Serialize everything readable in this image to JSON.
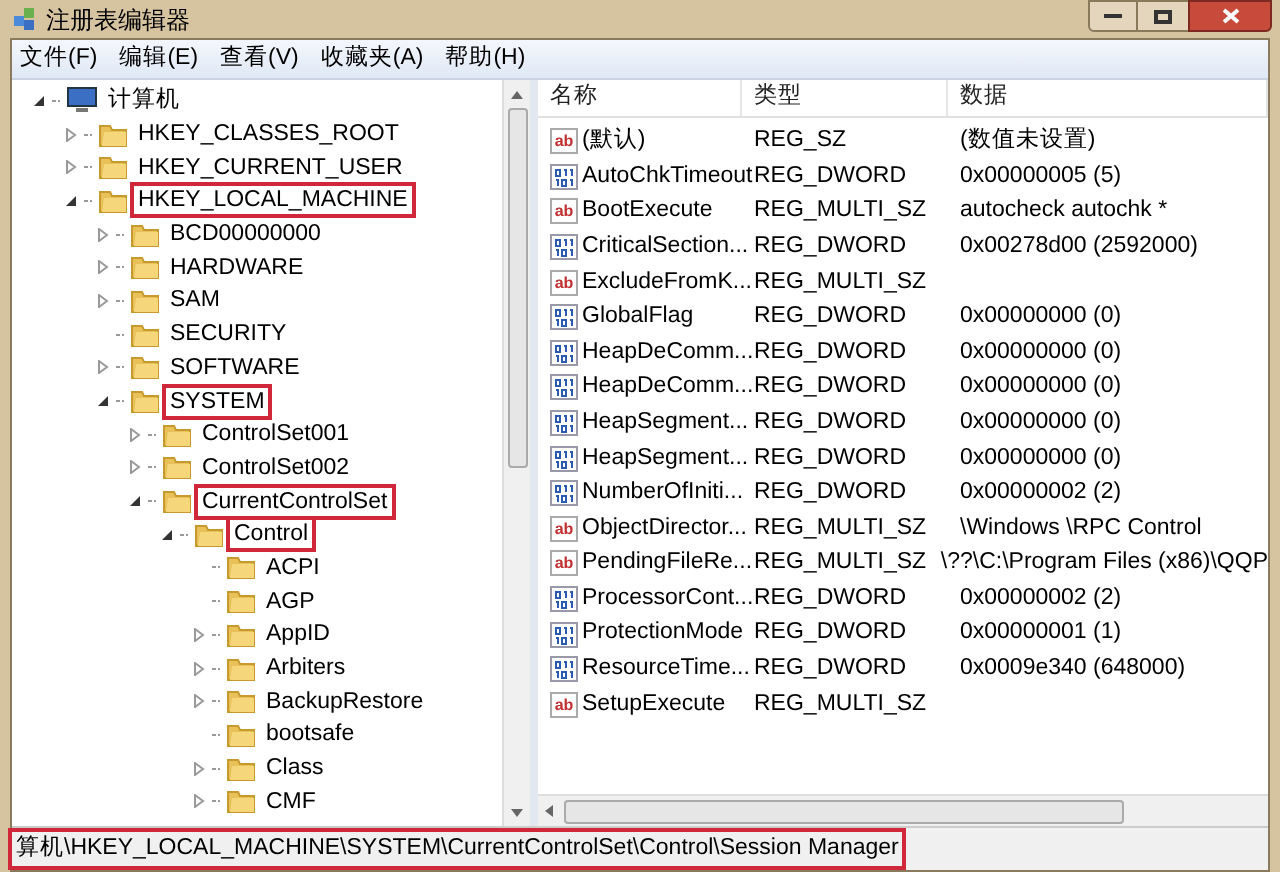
{
  "window": {
    "title": "注册表编辑器"
  },
  "menu": [
    "文件(F)",
    "编辑(E)",
    "查看(V)",
    "收藏夹(A)",
    "帮助(H)"
  ],
  "tree": [
    {
      "label": "计算机",
      "kind": "computer",
      "expanded": true,
      "highlighted": false,
      "children": [
        {
          "label": "HKEY_CLASSES_ROOT",
          "kind": "folder",
          "expanded": false,
          "highlighted": false
        },
        {
          "label": "HKEY_CURRENT_USER",
          "kind": "folder",
          "expanded": false,
          "highlighted": false
        },
        {
          "label": "HKEY_LOCAL_MACHINE",
          "kind": "folder",
          "expanded": true,
          "highlighted": true,
          "children": [
            {
              "label": "BCD00000000",
              "kind": "folder",
              "expanded": false,
              "highlighted": false
            },
            {
              "label": "HARDWARE",
              "kind": "folder",
              "expanded": false,
              "highlighted": false
            },
            {
              "label": "SAM",
              "kind": "folder",
              "expanded": false,
              "highlighted": false
            },
            {
              "label": "SECURITY",
              "kind": "folder",
              "highlighted": false
            },
            {
              "label": "SOFTWARE",
              "kind": "folder",
              "expanded": false,
              "highlighted": false
            },
            {
              "label": "SYSTEM",
              "kind": "folder",
              "expanded": true,
              "highlighted": true,
              "children": [
                {
                  "label": "ControlSet001",
                  "kind": "folder",
                  "expanded": false,
                  "highlighted": false
                },
                {
                  "label": "ControlSet002",
                  "kind": "folder",
                  "expanded": false,
                  "highlighted": false
                },
                {
                  "label": "CurrentControlSet",
                  "kind": "folder",
                  "expanded": true,
                  "highlighted": true,
                  "children": [
                    {
                      "label": "Control",
                      "kind": "folder",
                      "expanded": true,
                      "highlighted": true,
                      "children": [
                        {
                          "label": "ACPI",
                          "kind": "folder",
                          "highlighted": false
                        },
                        {
                          "label": "AGP",
                          "kind": "folder",
                          "highlighted": false
                        },
                        {
                          "label": "AppID",
                          "kind": "folder",
                          "expanded": false,
                          "highlighted": false
                        },
                        {
                          "label": "Arbiters",
                          "kind": "folder",
                          "expanded": false,
                          "highlighted": false
                        },
                        {
                          "label": "BackupRestore",
                          "kind": "folder",
                          "expanded": false,
                          "highlighted": false
                        },
                        {
                          "label": "bootsafe",
                          "kind": "folder",
                          "highlighted": false
                        },
                        {
                          "label": "Class",
                          "kind": "folder",
                          "expanded": false,
                          "highlighted": false
                        },
                        {
                          "label": "CMF",
                          "kind": "folder",
                          "expanded": false,
                          "highlighted": false
                        }
                      ]
                    }
                  ]
                }
              ]
            }
          ]
        }
      ]
    }
  ],
  "table": {
    "columns": [
      "名称",
      "类型",
      "数据"
    ],
    "rows": [
      {
        "kind": "string",
        "icon": "ab",
        "name": "(默认)",
        "type": "REG_SZ",
        "data": "(数值未设置)"
      },
      {
        "kind": "binary",
        "name": "AutoChkTimeout",
        "type": "REG_DWORD",
        "data": "0x00000005 (5)"
      },
      {
        "kind": "string",
        "icon": "ab",
        "name": "BootExecute",
        "type": "REG_MULTI_SZ",
        "data": "autocheck autochk *"
      },
      {
        "kind": "binary",
        "name": "CriticalSection...",
        "type": "REG_DWORD",
        "data": "0x00278d00 (2592000)"
      },
      {
        "kind": "string",
        "icon": "ab",
        "name": "ExcludeFromK...",
        "type": "REG_MULTI_SZ"
      },
      {
        "kind": "binary",
        "name": "GlobalFlag",
        "type": "REG_DWORD",
        "data": "0x00000000 (0)"
      },
      {
        "kind": "binary",
        "name": "HeapDeComm...",
        "type": "REG_DWORD",
        "data": "0x00000000 (0)"
      },
      {
        "kind": "binary",
        "name": "HeapDeComm...",
        "type": "REG_DWORD",
        "data": "0x00000000 (0)"
      },
      {
        "kind": "binary",
        "name": "HeapSegment...",
        "type": "REG_DWORD",
        "data": "0x00000000 (0)"
      },
      {
        "kind": "binary",
        "name": "HeapSegment...",
        "type": "REG_DWORD",
        "data": "0x00000000 (0)"
      },
      {
        "kind": "binary",
        "name": "NumberOfIniti...",
        "type": "REG_DWORD",
        "data": "0x00000002 (2)"
      },
      {
        "kind": "string",
        "icon": "ab",
        "name": "ObjectDirector...",
        "type": "REG_MULTI_SZ",
        "data": "\\Windows \\RPC Control"
      },
      {
        "kind": "string",
        "icon": "ab",
        "name": "PendingFileRe...",
        "type": "REG_MULTI_SZ",
        "data": "\\??\\C:\\Program Files (x86)\\QQP"
      },
      {
        "kind": "binary",
        "name": "ProcessorCont...",
        "type": "REG_DWORD",
        "data": "0x00000002 (2)"
      },
      {
        "kind": "binary",
        "name": "ProtectionMode",
        "type": "REG_DWORD",
        "data": "0x00000001 (1)"
      },
      {
        "kind": "binary",
        "name": "ResourceTime...",
        "type": "REG_DWORD",
        "data": "0x0009e340 (648000)"
      },
      {
        "kind": "string",
        "icon": "ab",
        "name": "SetupExecute",
        "type": "REG_MULTI_SZ"
      }
    ]
  },
  "status_bar": {
    "text": "算机\\HKEY_LOCAL_MACHINE\\SYSTEM\\CurrentControlSet\\Control\\Session Manager",
    "highlighted": true
  }
}
